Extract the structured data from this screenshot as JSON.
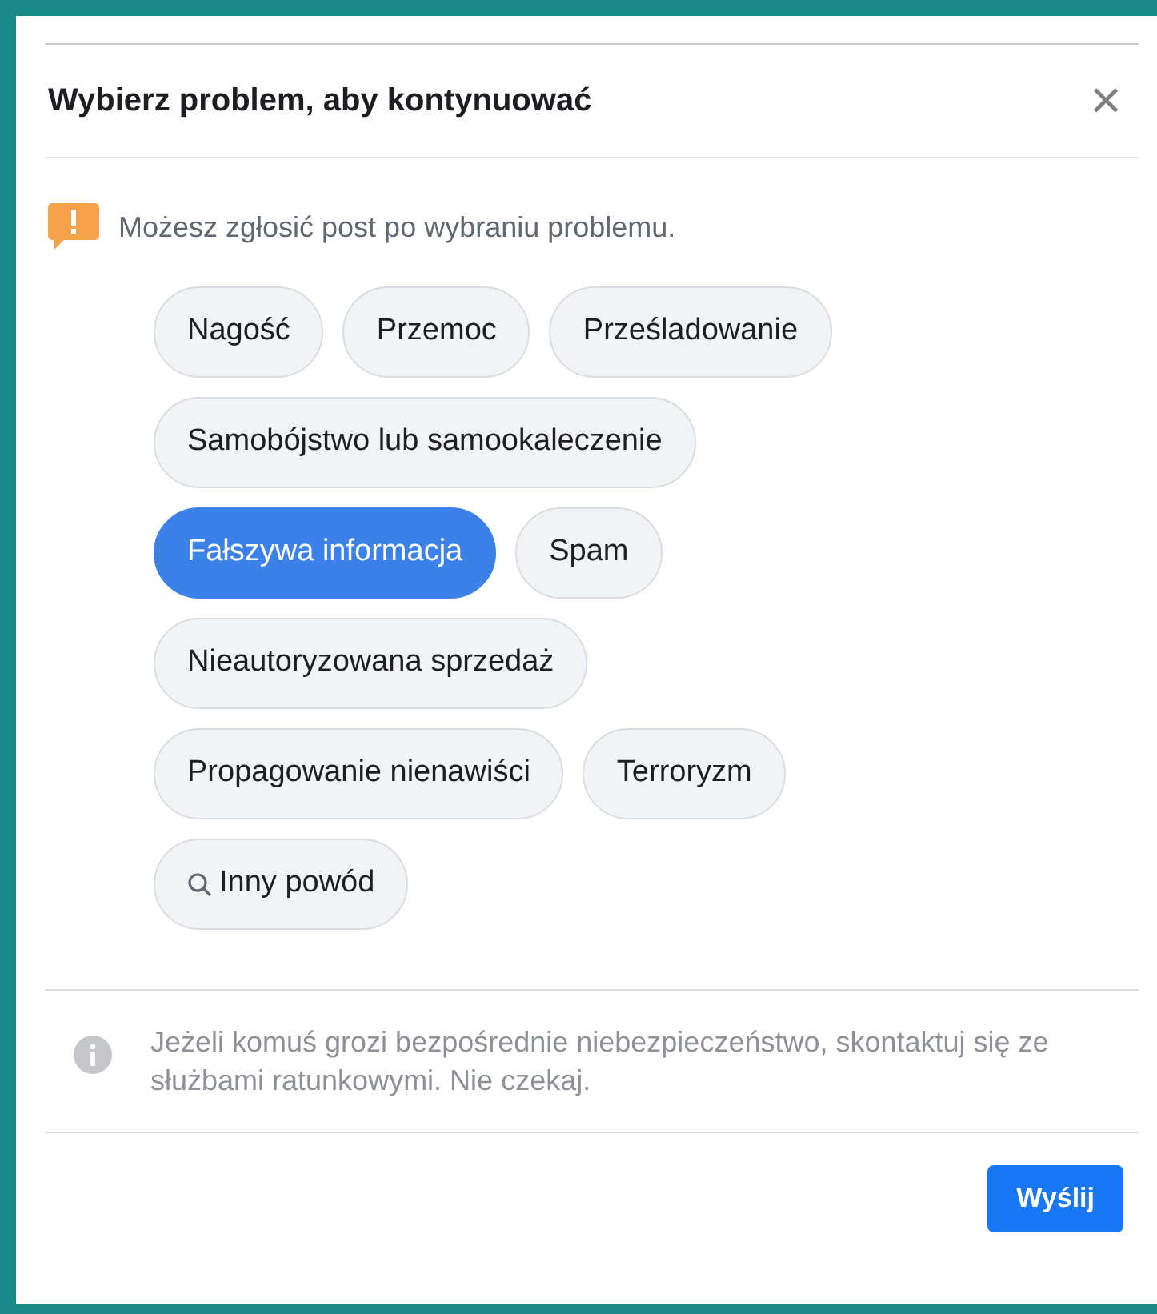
{
  "dialog": {
    "title": "Wybierz problem, aby kontynuować",
    "close": "×"
  },
  "notice": "Możesz zgłosić post po wybraniu problemu.",
  "chip_rows": [
    [
      {
        "label": "Nagość",
        "selected": false,
        "kind": "plain"
      },
      {
        "label": "Przemoc",
        "selected": false,
        "kind": "plain"
      },
      {
        "label": "Prześladowanie",
        "selected": false,
        "kind": "plain"
      }
    ],
    [
      {
        "label": "Samobójstwo lub samookaleczenie",
        "selected": false,
        "kind": "plain"
      }
    ],
    [
      {
        "label": "Fałszywa informacja",
        "selected": true,
        "kind": "plain"
      },
      {
        "label": "Spam",
        "selected": false,
        "kind": "plain"
      }
    ],
    [
      {
        "label": "Nieautoryzowana sprzedaż",
        "selected": false,
        "kind": "plain"
      }
    ],
    [
      {
        "label": "Propagowanie nienawiści",
        "selected": false,
        "kind": "plain"
      },
      {
        "label": "Terroryzm",
        "selected": false,
        "kind": "plain"
      }
    ],
    [
      {
        "label": "Inny powód",
        "selected": false,
        "kind": "search"
      }
    ]
  ],
  "info": "Jeżeli komuś grozi bezpośrednie niebezpieczeństwo, skontaktuj się ze służbami ratunkowymi. Nie czekaj.",
  "submit": "Wyślij"
}
